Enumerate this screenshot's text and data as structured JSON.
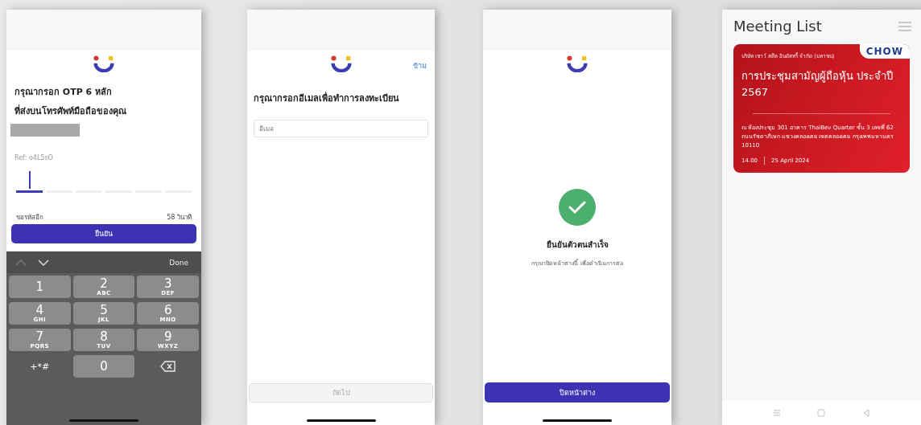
{
  "otp_screen": {
    "title": "กรุณากรอก OTP 6 หลัก",
    "subtitle": "ที่ส่งบนโทรศัพท์มือถือของคุณ",
    "ref": "Ref: o4L5sO",
    "otp_slots": [
      {
        "selected": true
      },
      {
        "selected": false
      },
      {
        "selected": false
      },
      {
        "selected": false
      },
      {
        "selected": false
      },
      {
        "selected": false
      }
    ],
    "resend_label": "ขอรหัสอีก",
    "countdown": "58 วินาที",
    "confirm_button": "ยืนยัน",
    "keyboard": {
      "done": "Done",
      "keys": [
        {
          "kind": "digit",
          "digit": "1"
        },
        {
          "kind": "digit",
          "digit": "2",
          "letters": "ABC"
        },
        {
          "kind": "digit",
          "digit": "3",
          "letters": "DEF"
        },
        {
          "kind": "digit",
          "digit": "4",
          "letters": "GHI"
        },
        {
          "kind": "digit",
          "digit": "5",
          "letters": "JKL"
        },
        {
          "kind": "digit",
          "digit": "6",
          "letters": "MNO"
        },
        {
          "kind": "digit",
          "digit": "7",
          "letters": "PQRS"
        },
        {
          "kind": "digit",
          "digit": "8",
          "letters": "TUV"
        },
        {
          "kind": "digit",
          "digit": "9",
          "letters": "WXYZ"
        },
        {
          "kind": "symbols",
          "digit": "+*#"
        },
        {
          "kind": "digit",
          "digit": "0"
        },
        {
          "kind": "delete"
        }
      ]
    }
  },
  "email_screen": {
    "skip_link": "ข้าม",
    "title": "กรุณากรอกอีเมลเพื่อทำการลงทะเบียน",
    "email_field": {
      "placeholder": "อีเมล"
    },
    "next_button": {
      "label": "ถัดไป",
      "disabled": true
    }
  },
  "success_screen": {
    "title": "ยืนยันตัวตนสำเร็จ",
    "message": "กรุณาปิดหน้าต่างนี้ เพื่อดำเนินการต่อ",
    "close_button": "ปิดหน้าต่าง"
  },
  "meeting_list_screen": {
    "title": "Meeting List",
    "meetings": [
      {
        "company": "บริษัท เชาว์ สตีล อินดัสทรี้ จำกัด (มหาชน)",
        "logo_text": "CHOW",
        "title": "การประชุมสามัญผู้ถือหุ้น ประจำปี 2567",
        "location": "ณ ห้องประชุม 301 อาคาร ThaiBev Quarter ชั้น 3 เลขที่ 62 ถนนรัชดาภิเษก แขวงคลองเตย เขตคลองเตย กรุงเทพมหานคร 10110",
        "time": "14.00",
        "date": "25 April 2024"
      }
    ]
  }
}
